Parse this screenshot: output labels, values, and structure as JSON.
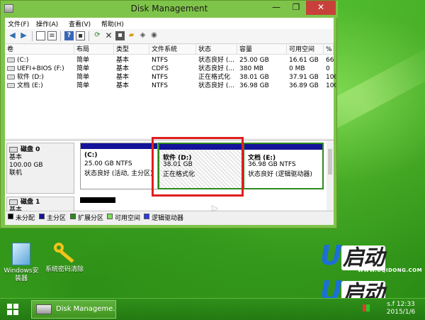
{
  "window": {
    "title": "Disk Management",
    "minimize_glyph": "—",
    "maximize_glyph": "❐",
    "close_glyph": "✕"
  },
  "menu": [
    "文件(F)",
    "操作(A)",
    "查看(V)",
    "帮助(H)"
  ],
  "toolbar": {
    "icons": [
      "back-arrow-icon",
      "forward-arrow-icon",
      "properties-icon",
      "list-view-icon",
      "help-icon",
      "refresh-icon",
      "delete-icon",
      "settings-icon",
      "open-folder-icon",
      "checkdisk-icon",
      "rescan-icon"
    ]
  },
  "volume_table": {
    "headers": [
      "卷",
      "布局",
      "类型",
      "文件系统",
      "状态",
      "容量",
      "可用空间",
      "%"
    ],
    "rows": [
      {
        "volume": "(C:)",
        "layout": "简单",
        "type": "基本",
        "fs": "NTFS",
        "status": "状态良好 (...",
        "capacity": "25.00 GB",
        "free": "16.61 GB",
        "pct": "66"
      },
      {
        "volume": "UEFI+BIOS (F:)",
        "layout": "简单",
        "type": "基本",
        "fs": "CDFS",
        "status": "状态良好 (...",
        "capacity": "380 MB",
        "free": "0 MB",
        "pct": "0"
      },
      {
        "volume": "软件 (D:)",
        "layout": "简单",
        "type": "基本",
        "fs": "NTFS",
        "status": "正在格式化",
        "capacity": "38.01 GB",
        "free": "37.91 GB",
        "pct": "100"
      },
      {
        "volume": "文档 (E:)",
        "layout": "简单",
        "type": "基本",
        "fs": "NTFS",
        "status": "状态良好 (...",
        "capacity": "36.98 GB",
        "free": "36.89 GB",
        "pct": "100"
      }
    ]
  },
  "disks": [
    {
      "name": "磁盘 0",
      "type": "基本",
      "size": "100.00 GB",
      "state": "联机",
      "partitions": [
        {
          "title": "(C:)",
          "line1": "25.00 GB NTFS",
          "line2": "状态良好 (活动, 主分区)"
        },
        {
          "title": "软件  (D:)",
          "line1": "38.01 GB",
          "line2": "正在格式化"
        },
        {
          "title": "文档  (E:)",
          "line1": "36.98 GB NTFS",
          "line2": "状态良好 (逻辑驱动器)"
        }
      ]
    },
    {
      "name": "磁盘 1",
      "type": "基本"
    }
  ],
  "legend": [
    {
      "label": "未分配",
      "color": "#000000"
    },
    {
      "label": "主分区",
      "color": "#14149a"
    },
    {
      "label": "扩展分区",
      "color": "#2f8a1e"
    },
    {
      "label": "可用空间",
      "color": "#7ee05a"
    },
    {
      "label": "逻辑驱动器",
      "color": "#2b3be6"
    }
  ],
  "desktop_icons": [
    {
      "label_line1": "Windows安",
      "label_line2": "装器"
    },
    {
      "label_line1": "系统密码清除",
      "label_line2": ""
    }
  ],
  "brand": {
    "mark": "U",
    "name": "启动",
    "url": "WWW.UQIDONG.COM"
  },
  "taskbar": {
    "task_label": "Disk Manageme...",
    "clock_time": "12:33",
    "clock_date": "2015/1/6",
    "tray_text": "s.f"
  }
}
